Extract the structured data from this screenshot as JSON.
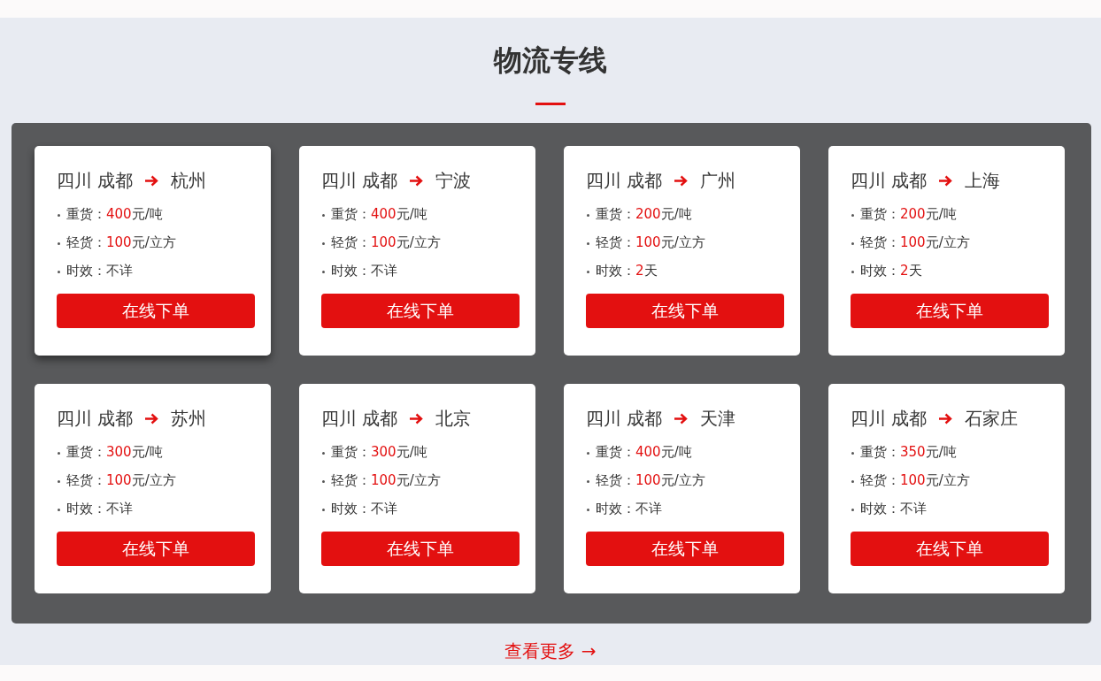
{
  "section": {
    "title": "物流专线"
  },
  "routes": [
    {
      "origin": "四川 成都",
      "destination": "杭州",
      "highlighted": true,
      "details": [
        {
          "label": "重货：",
          "value": "400",
          "unit": "元/吨"
        },
        {
          "label": "轻货：",
          "value": "100",
          "unit": "元/立方"
        },
        {
          "label": "时效：",
          "note": "不详"
        }
      ],
      "button": "在线下单"
    },
    {
      "origin": "四川 成都",
      "destination": "宁波",
      "highlighted": false,
      "details": [
        {
          "label": "重货：",
          "value": "400",
          "unit": "元/吨"
        },
        {
          "label": "轻货：",
          "value": "100",
          "unit": "元/立方"
        },
        {
          "label": "时效：",
          "note": "不详"
        }
      ],
      "button": "在线下单"
    },
    {
      "origin": "四川 成都",
      "destination": "广州",
      "highlighted": false,
      "details": [
        {
          "label": "重货：",
          "value": "200",
          "unit": "元/吨"
        },
        {
          "label": "轻货：",
          "value": "100",
          "unit": "元/立方"
        },
        {
          "label": "时效：",
          "value": "2",
          "unit": "天"
        }
      ],
      "button": "在线下单"
    },
    {
      "origin": "四川 成都",
      "destination": "上海",
      "highlighted": false,
      "details": [
        {
          "label": "重货：",
          "value": "200",
          "unit": "元/吨"
        },
        {
          "label": "轻货：",
          "value": "100",
          "unit": "元/立方"
        },
        {
          "label": "时效：",
          "value": "2",
          "unit": "天"
        }
      ],
      "button": "在线下单"
    },
    {
      "origin": "四川 成都",
      "destination": "苏州",
      "highlighted": false,
      "details": [
        {
          "label": "重货：",
          "value": "300",
          "unit": "元/吨"
        },
        {
          "label": "轻货：",
          "value": "100",
          "unit": "元/立方"
        },
        {
          "label": "时效：",
          "note": "不详"
        }
      ],
      "button": "在线下单"
    },
    {
      "origin": "四川 成都",
      "destination": "北京",
      "highlighted": false,
      "details": [
        {
          "label": "重货：",
          "value": "300",
          "unit": "元/吨"
        },
        {
          "label": "轻货：",
          "value": "100",
          "unit": "元/立方"
        },
        {
          "label": "时效：",
          "note": "不详"
        }
      ],
      "button": "在线下单"
    },
    {
      "origin": "四川 成都",
      "destination": "天津",
      "highlighted": false,
      "details": [
        {
          "label": "重货：",
          "value": "400",
          "unit": "元/吨"
        },
        {
          "label": "轻货：",
          "value": "100",
          "unit": "元/立方"
        },
        {
          "label": "时效：",
          "note": "不详"
        }
      ],
      "button": "在线下单"
    },
    {
      "origin": "四川 成都",
      "destination": "石家庄",
      "highlighted": false,
      "details": [
        {
          "label": "重货：",
          "value": "350",
          "unit": "元/吨"
        },
        {
          "label": "轻货：",
          "value": "100",
          "unit": "元/立方"
        },
        {
          "label": "时效：",
          "note": "不详"
        }
      ],
      "button": "在线下单"
    }
  ],
  "more_link": "查看更多 →"
}
